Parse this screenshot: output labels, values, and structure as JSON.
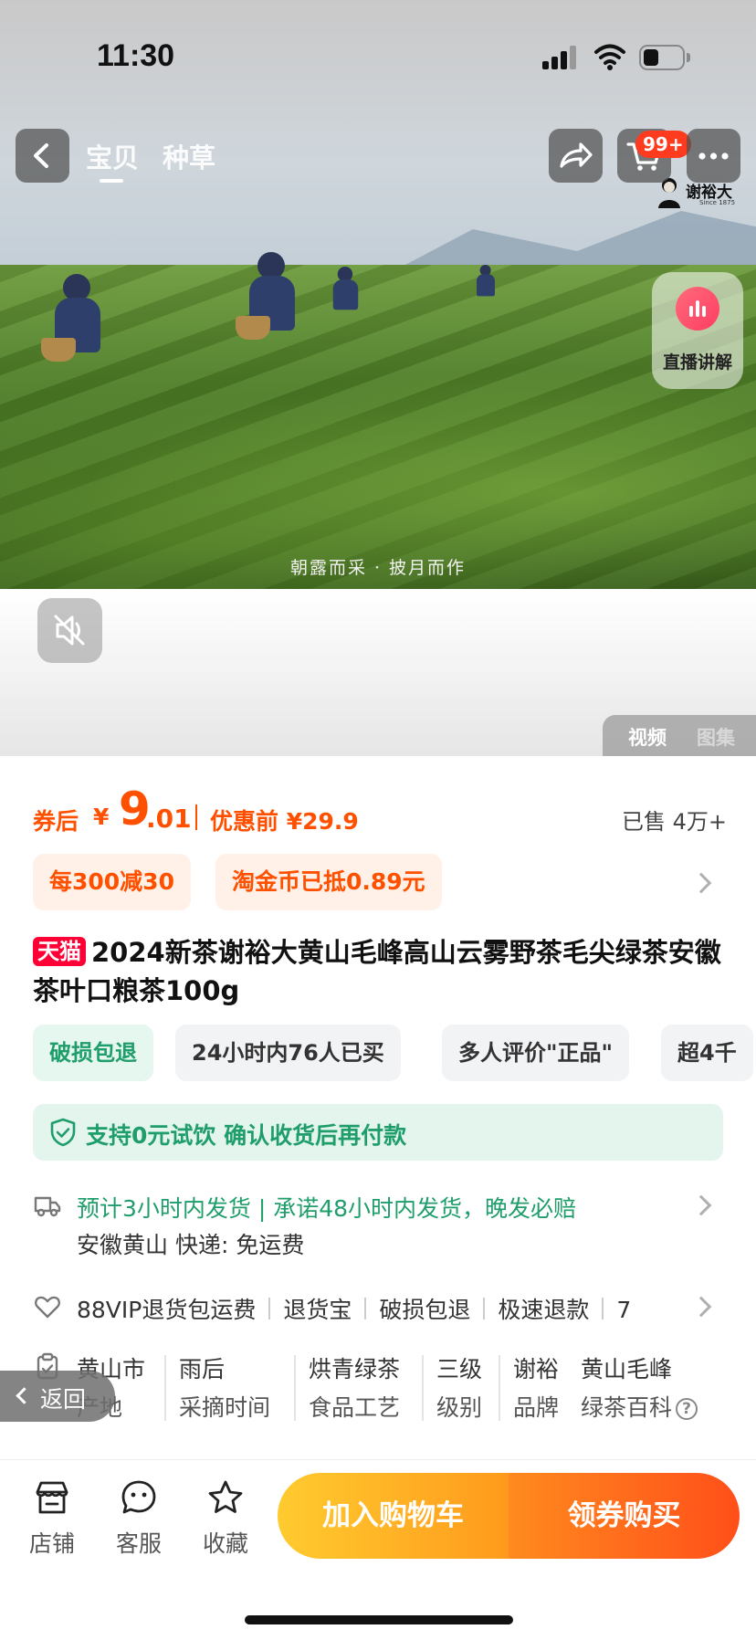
{
  "status_bar": {
    "time": "11:30"
  },
  "nav": {
    "tabs": [
      "宝贝",
      "种草"
    ],
    "cart_badge": "99+"
  },
  "media": {
    "brand_logo_text": "谢裕大",
    "brand_logo_sub": "Since 1875",
    "video_caption": "朝露而采 · 披月而作",
    "live_label": "直播讲解",
    "toggle": [
      "视频",
      "图集"
    ],
    "icons": [
      "back-icon",
      "share-icon",
      "cart-icon",
      "more-icon",
      "live-bars-icon",
      "mute-icon"
    ]
  },
  "price": {
    "prefix": "券后",
    "currency": "¥",
    "integer": "9",
    "decimal": ".01",
    "original": "优惠前 ¥29.9",
    "sold": "已售 4万+"
  },
  "promos": [
    "每300减30",
    "淘金币已抵0.89元"
  ],
  "product": {
    "badge": "天猫",
    "title": "2024新茶谢裕大黄山毛峰高山云雾野茶毛尖绿茶安徽茶叶口粮茶100g"
  },
  "tags": [
    "破损包退",
    "24小时内76人已买",
    "多人评价\"正品\"",
    "超4千"
  ],
  "trial": "支持0元试饮 确认收货后再付款",
  "shipping": {
    "line1": "预计3小时内发货 | 承诺48小时内发货，晚发必赔",
    "line2": "安徽黄山  快递: 免运费"
  },
  "services": [
    "88VIP退货包运费",
    "退货宝",
    "破损包退",
    "极速退款",
    "7"
  ],
  "attributes": [
    {
      "value": "黄山市",
      "key": "产地"
    },
    {
      "value": "雨后",
      "key": "采摘时间"
    },
    {
      "value": "烘青绿茶",
      "key": "食品工艺"
    },
    {
      "value": "三级",
      "key": "级别"
    },
    {
      "value": "谢裕",
      "key": "品牌"
    },
    {
      "value": "黄山毛峰",
      "key": "绿茶百科"
    }
  ],
  "return_button": "返回",
  "bottom_bar": {
    "items": [
      "店铺",
      "客服",
      "收藏"
    ],
    "add_to_cart": "加入购物车",
    "buy_with_coupon": "领券购买"
  },
  "colors": {
    "accent_orange": "#ff5000",
    "accent_green": "#1f9e6b",
    "tmall_red": "#ff0036"
  }
}
